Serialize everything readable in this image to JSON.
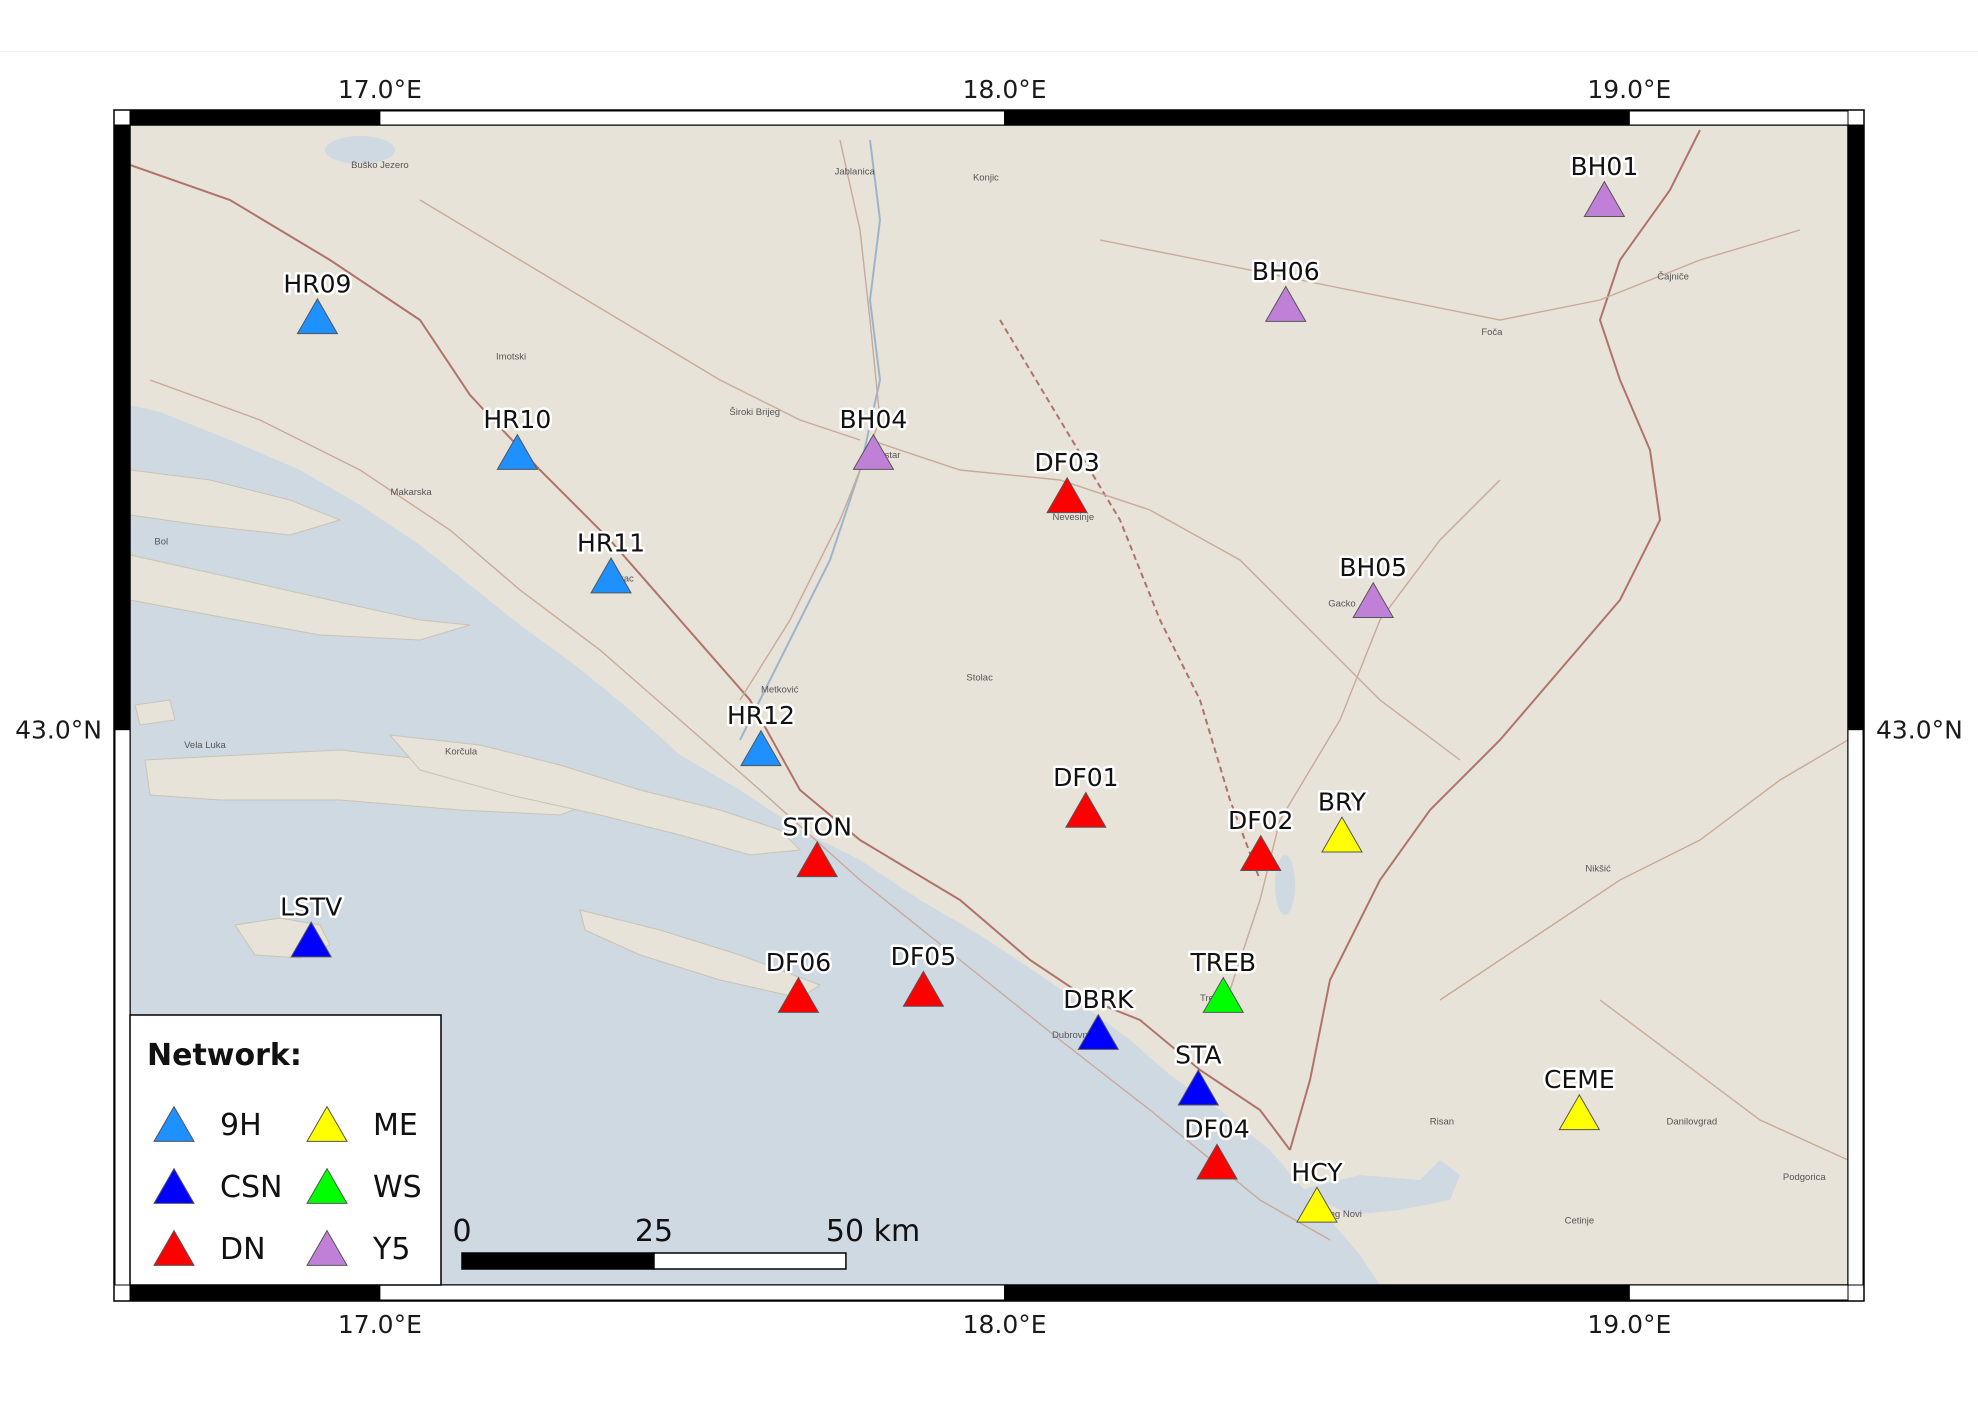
{
  "map": {
    "lon_range": [
      16.6,
      19.35
    ],
    "lat_range": [
      42.1,
      43.98
    ],
    "lon_ticks": [
      {
        "value": 17.0,
        "label": "17.0°E"
      },
      {
        "value": 18.0,
        "label": "18.0°E"
      },
      {
        "value": 19.0,
        "label": "19.0°E"
      }
    ],
    "lat_ticks": [
      {
        "value": 43.0,
        "label": "43.0°N"
      }
    ],
    "colors": {
      "land": "#e7e3d9",
      "sea": "#cfd9e2",
      "border": "#b0736a",
      "road": "#c9a999",
      "frame": "#000000"
    }
  },
  "networks": [
    {
      "code": "9H",
      "color": "#1e90ff"
    },
    {
      "code": "CSN",
      "color": "#0000ff"
    },
    {
      "code": "DN",
      "color": "#ff0000"
    },
    {
      "code": "ME",
      "color": "#ffff00"
    },
    {
      "code": "WS",
      "color": "#00ff00"
    },
    {
      "code": "Y5",
      "color": "#c080d8"
    }
  ],
  "stations": [
    {
      "name": "HR09",
      "network": "9H",
      "lon": 16.9,
      "lat": 43.67
    },
    {
      "name": "HR10",
      "network": "9H",
      "lon": 17.22,
      "lat": 43.45
    },
    {
      "name": "HR11",
      "network": "9H",
      "lon": 17.37,
      "lat": 43.25
    },
    {
      "name": "HR12",
      "network": "9H",
      "lon": 17.61,
      "lat": 42.97
    },
    {
      "name": "LSTV",
      "network": "CSN",
      "lon": 16.89,
      "lat": 42.66
    },
    {
      "name": "DBRK",
      "network": "CSN",
      "lon": 18.15,
      "lat": 42.51
    },
    {
      "name": "STA",
      "network": "CSN",
      "lon": 18.31,
      "lat": 42.42
    },
    {
      "name": "STON",
      "network": "DN",
      "lon": 17.7,
      "lat": 42.79
    },
    {
      "name": "DF06",
      "network": "DN",
      "lon": 17.67,
      "lat": 42.57
    },
    {
      "name": "DF05",
      "network": "DN",
      "lon": 17.87,
      "lat": 42.58
    },
    {
      "name": "DF03",
      "network": "DN",
      "lon": 18.1,
      "lat": 43.38
    },
    {
      "name": "DF01",
      "network": "DN",
      "lon": 18.13,
      "lat": 42.87
    },
    {
      "name": "DF02",
      "network": "DN",
      "lon": 18.41,
      "lat": 42.8
    },
    {
      "name": "DF04",
      "network": "DN",
      "lon": 18.34,
      "lat": 42.3
    },
    {
      "name": "BRY",
      "network": "ME",
      "lon": 18.54,
      "lat": 42.83
    },
    {
      "name": "CEME",
      "network": "ME",
      "lon": 18.92,
      "lat": 42.38
    },
    {
      "name": "HCY",
      "network": "ME",
      "lon": 18.5,
      "lat": 42.23
    },
    {
      "name": "TREB",
      "network": "WS",
      "lon": 18.35,
      "lat": 42.57
    },
    {
      "name": "BH01",
      "network": "Y5",
      "lon": 18.96,
      "lat": 43.86
    },
    {
      "name": "BH06",
      "network": "Y5",
      "lon": 18.45,
      "lat": 43.69
    },
    {
      "name": "BH04",
      "network": "Y5",
      "lon": 17.79,
      "lat": 43.45
    },
    {
      "name": "BH05",
      "network": "Y5",
      "lon": 18.59,
      "lat": 43.21
    }
  ],
  "places": [
    {
      "name": "Jablanica",
      "lon": 17.76,
      "lat": 43.9
    },
    {
      "name": "Konjic",
      "lon": 17.97,
      "lat": 43.89
    },
    {
      "name": "Buško Jezero",
      "lon": 17.0,
      "lat": 43.91
    },
    {
      "name": "Imotski",
      "lon": 17.21,
      "lat": 43.6
    },
    {
      "name": "Široki Brijeg",
      "lon": 17.6,
      "lat": 43.51
    },
    {
      "name": "Mostar",
      "lon": 17.81,
      "lat": 43.44
    },
    {
      "name": "Makarska",
      "lon": 17.05,
      "lat": 43.38
    },
    {
      "name": "Nevesinje",
      "lon": 18.11,
      "lat": 43.34
    },
    {
      "name": "Bol",
      "lon": 16.65,
      "lat": 43.3
    },
    {
      "name": "Vrgorac",
      "lon": 17.38,
      "lat": 43.24
    },
    {
      "name": "Gacko",
      "lon": 18.54,
      "lat": 43.2
    },
    {
      "name": "Stolac",
      "lon": 17.96,
      "lat": 43.08
    },
    {
      "name": "Metković",
      "lon": 17.64,
      "lat": 43.06
    },
    {
      "name": "Vela Luka",
      "lon": 16.72,
      "lat": 42.97
    },
    {
      "name": "Korčula",
      "lon": 17.13,
      "lat": 42.96
    },
    {
      "name": "Foča",
      "lon": 18.78,
      "lat": 43.64
    },
    {
      "name": "Čajniče",
      "lon": 19.07,
      "lat": 43.73
    },
    {
      "name": "Nikšić",
      "lon": 18.95,
      "lat": 42.77
    },
    {
      "name": "Trebinje",
      "lon": 18.34,
      "lat": 42.56
    },
    {
      "name": "Dubrovnik",
      "lon": 18.11,
      "lat": 42.5
    },
    {
      "name": "Risan",
      "lon": 18.7,
      "lat": 42.36
    },
    {
      "name": "Herceg Novi",
      "lon": 18.53,
      "lat": 42.21
    },
    {
      "name": "Danilovgrad",
      "lon": 19.1,
      "lat": 42.36
    },
    {
      "name": "Cetinje",
      "lon": 18.92,
      "lat": 42.2
    },
    {
      "name": "Podgorica",
      "lon": 19.28,
      "lat": 42.27
    }
  ],
  "legend": {
    "title": "Network:"
  },
  "scale_bar": {
    "labels": [
      "0",
      "25",
      "50 km"
    ],
    "km_values": [
      0,
      25,
      50
    ]
  }
}
